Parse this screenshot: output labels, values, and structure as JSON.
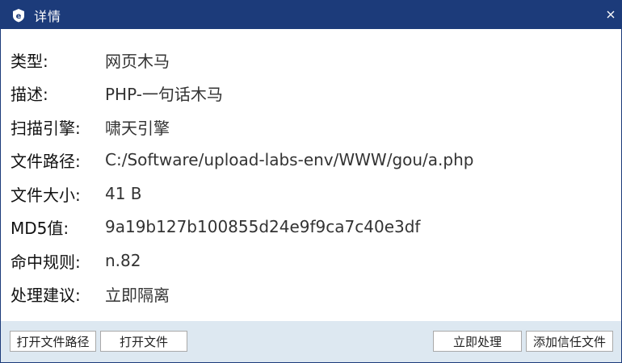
{
  "window": {
    "title": "详情"
  },
  "details": [
    {
      "label": "类型:",
      "value": "网页木马"
    },
    {
      "label": "描述:",
      "value": "PHP-一句话木马"
    },
    {
      "label": "扫描引擎:",
      "value": "啸天引擎"
    },
    {
      "label": "文件路径:",
      "value": "C:/Software/upload-labs-env/WWW/gou/a.php"
    },
    {
      "label": "文件大小:",
      "value": "41 B"
    },
    {
      "label": "MD5值:",
      "value": "9a19b127b100855d24e9f9ca7c40e3df"
    },
    {
      "label": "命中规则:",
      "value": "n.82"
    },
    {
      "label": "处理建议:",
      "value": "立即隔离"
    }
  ],
  "buttons": {
    "open_path": "打开文件路径",
    "open_file": "打开文件",
    "handle_now": "立即处理",
    "add_trust": "添加信任文件"
  },
  "colors": {
    "titlebar": "#1c3b7a",
    "footer": "#dde8f1"
  }
}
